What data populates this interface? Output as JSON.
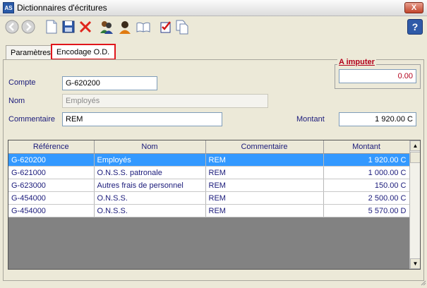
{
  "window": {
    "title": "Dictionnaires d'écritures",
    "app_icon_text": "AS",
    "close_label": "X",
    "help_label": "?"
  },
  "toolbar": {
    "buttons": [
      "back-icon",
      "forward-icon",
      "new-document-icon",
      "save-icon",
      "delete-icon",
      "users-icon",
      "user-icon",
      "open-book-icon",
      "checklist-icon",
      "copy-icon",
      "help-icon"
    ]
  },
  "tabs": [
    {
      "label": "Paramètres",
      "active": false
    },
    {
      "label": "Encodage O.D.",
      "active": true
    }
  ],
  "form": {
    "compte_label": "Compte",
    "compte_value": "G-620200",
    "nom_label": "Nom",
    "nom_value": "Employés",
    "commentaire_label": "Commentaire",
    "commentaire_value": "REM",
    "montant_label": "Montant",
    "montant_value": "1 920.00 C",
    "imputer_label": "A imputer",
    "imputer_value": "0.00"
  },
  "grid": {
    "columns": [
      "Référence",
      "Nom",
      "Commentaire",
      "Montant"
    ],
    "rows": [
      {
        "reference": "G-620200",
        "nom": "Employés",
        "commentaire": "REM",
        "montant": "1 920.00 C",
        "selected": true
      },
      {
        "reference": "G-621000",
        "nom": "O.N.S.S. patronale",
        "commentaire": "REM",
        "montant": "1 000.00 C",
        "selected": false
      },
      {
        "reference": "G-623000",
        "nom": "Autres frais de personnel",
        "commentaire": "REM",
        "montant": "150.00 C",
        "selected": false
      },
      {
        "reference": "G-454000",
        "nom": "O.N.S.S.",
        "commentaire": "REM",
        "montant": "2 500.00 C",
        "selected": false
      },
      {
        "reference": "G-454000",
        "nom": "O.N.S.S.",
        "commentaire": "REM",
        "montant": "5 570.00 D",
        "selected": false
      }
    ]
  },
  "colors": {
    "selection": "#3399ff",
    "label_text": "#1a1a7a",
    "imputer_text": "#b3001b",
    "active_tab_border": "#e0161b"
  }
}
